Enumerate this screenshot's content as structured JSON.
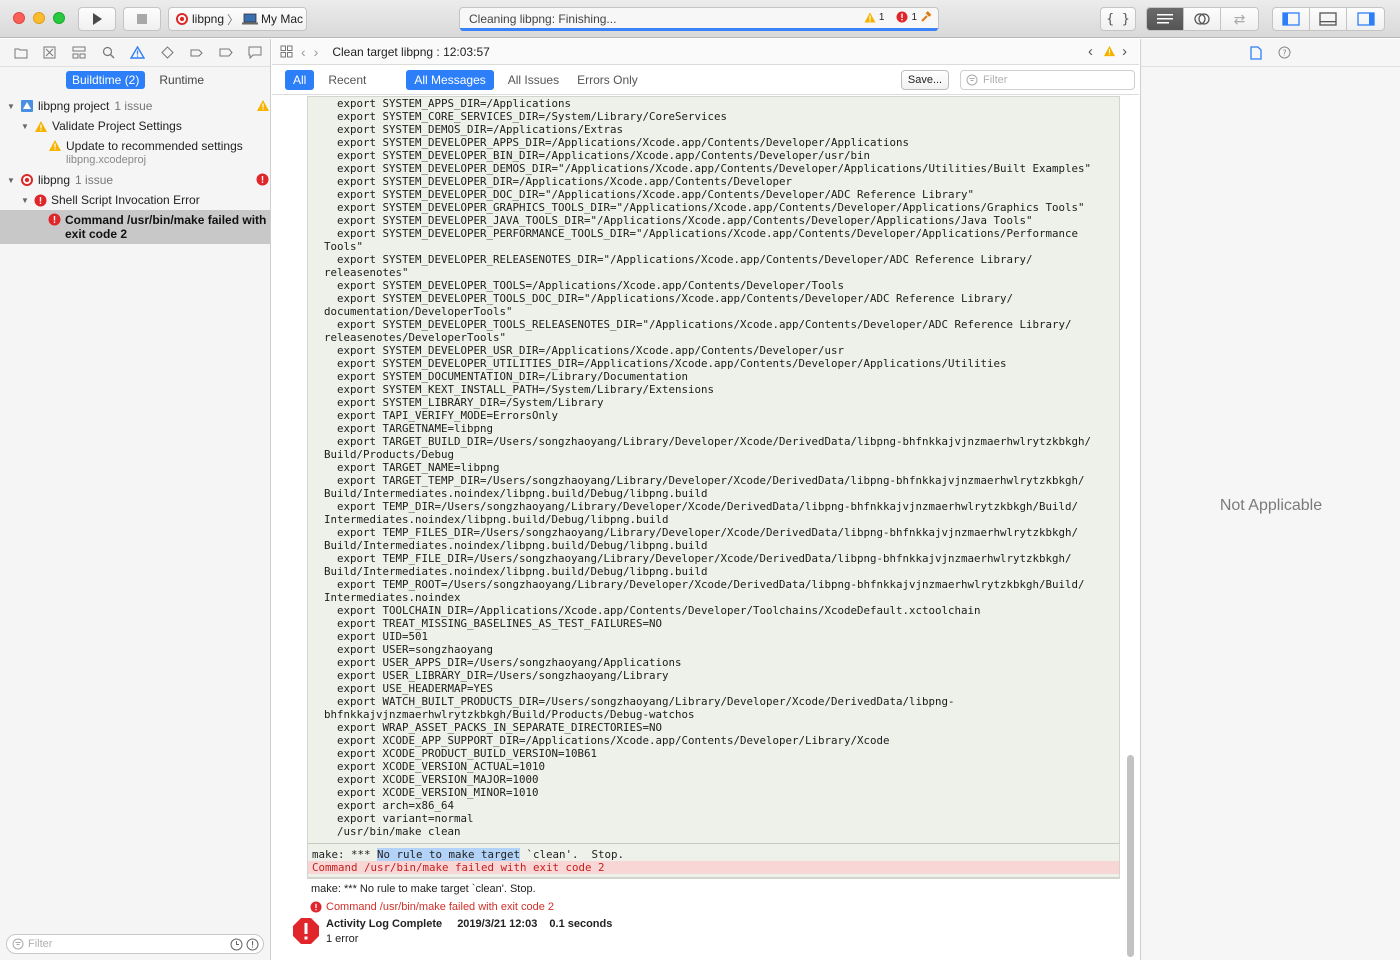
{
  "toolbar": {
    "scheme_name": "libpng",
    "destination": "My Mac",
    "activity_text": "Cleaning libpng: Finishing...",
    "warning_count": "1",
    "error_count": "1"
  },
  "navigator": {
    "mode_tabs": [
      "Buildtime (2)",
      "Runtime"
    ],
    "items": [
      {
        "label": "libpng project",
        "meta": "1 issue"
      },
      {
        "label": "Validate Project Settings"
      },
      {
        "label": "Update to recommended settings",
        "sub": "libpng.xcodeproj"
      },
      {
        "label": "libpng",
        "meta": "1 issue"
      },
      {
        "label": "Shell Script Invocation Error"
      },
      {
        "label_line1": "Command /usr/bin/make failed with",
        "label_line2": "exit code 2"
      }
    ],
    "filter_placeholder": "Filter"
  },
  "editor": {
    "jump_title": "Clean target libpng : 12:03:57",
    "filter_tabs": [
      "All",
      "Recent",
      "All Messages",
      "All Issues",
      "Errors Only"
    ],
    "save_label": "Save...",
    "filter_placeholder": "Filter",
    "log_text": "  export SYSTEM_APPS_DIR=/Applications\n  export SYSTEM_CORE_SERVICES_DIR=/System/Library/CoreServices\n  export SYSTEM_DEMOS_DIR=/Applications/Extras\n  export SYSTEM_DEVELOPER_APPS_DIR=/Applications/Xcode.app/Contents/Developer/Applications\n  export SYSTEM_DEVELOPER_BIN_DIR=/Applications/Xcode.app/Contents/Developer/usr/bin\n  export SYSTEM_DEVELOPER_DEMOS_DIR=\"/Applications/Xcode.app/Contents/Developer/Applications/Utilities/Built Examples\"\n  export SYSTEM_DEVELOPER_DIR=/Applications/Xcode.app/Contents/Developer\n  export SYSTEM_DEVELOPER_DOC_DIR=\"/Applications/Xcode.app/Contents/Developer/ADC Reference Library\"\n  export SYSTEM_DEVELOPER_GRAPHICS_TOOLS_DIR=\"/Applications/Xcode.app/Contents/Developer/Applications/Graphics Tools\"\n  export SYSTEM_DEVELOPER_JAVA_TOOLS_DIR=\"/Applications/Xcode.app/Contents/Developer/Applications/Java Tools\"\n  export SYSTEM_DEVELOPER_PERFORMANCE_TOOLS_DIR=\"/Applications/Xcode.app/Contents/Developer/Applications/Performance\nTools\"\n  export SYSTEM_DEVELOPER_RELEASENOTES_DIR=\"/Applications/Xcode.app/Contents/Developer/ADC Reference Library/\nreleasenotes\"\n  export SYSTEM_DEVELOPER_TOOLS=/Applications/Xcode.app/Contents/Developer/Tools\n  export SYSTEM_DEVELOPER_TOOLS_DOC_DIR=\"/Applications/Xcode.app/Contents/Developer/ADC Reference Library/\ndocumentation/DeveloperTools\"\n  export SYSTEM_DEVELOPER_TOOLS_RELEASENOTES_DIR=\"/Applications/Xcode.app/Contents/Developer/ADC Reference Library/\nreleasenotes/DeveloperTools\"\n  export SYSTEM_DEVELOPER_USR_DIR=/Applications/Xcode.app/Contents/Developer/usr\n  export SYSTEM_DEVELOPER_UTILITIES_DIR=/Applications/Xcode.app/Contents/Developer/Applications/Utilities\n  export SYSTEM_DOCUMENTATION_DIR=/Library/Documentation\n  export SYSTEM_KEXT_INSTALL_PATH=/System/Library/Extensions\n  export SYSTEM_LIBRARY_DIR=/System/Library\n  export TAPI_VERIFY_MODE=ErrorsOnly\n  export TARGETNAME=libpng\n  export TARGET_BUILD_DIR=/Users/songzhaoyang/Library/Developer/Xcode/DerivedData/libpng-bhfnkkajvjnzmaerhwlrytzkbkgh/\nBuild/Products/Debug\n  export TARGET_NAME=libpng\n  export TARGET_TEMP_DIR=/Users/songzhaoyang/Library/Developer/Xcode/DerivedData/libpng-bhfnkkajvjnzmaerhwlrytzkbkgh/\nBuild/Intermediates.noindex/libpng.build/Debug/libpng.build\n  export TEMP_DIR=/Users/songzhaoyang/Library/Developer/Xcode/DerivedData/libpng-bhfnkkajvjnzmaerhwlrytzkbkgh/Build/\nIntermediates.noindex/libpng.build/Debug/libpng.build\n  export TEMP_FILES_DIR=/Users/songzhaoyang/Library/Developer/Xcode/DerivedData/libpng-bhfnkkajvjnzmaerhwlrytzkbkgh/\nBuild/Intermediates.noindex/libpng.build/Debug/libpng.build\n  export TEMP_FILE_DIR=/Users/songzhaoyang/Library/Developer/Xcode/DerivedData/libpng-bhfnkkajvjnzmaerhwlrytzkbkgh/\nBuild/Intermediates.noindex/libpng.build/Debug/libpng.build\n  export TEMP_ROOT=/Users/songzhaoyang/Library/Developer/Xcode/DerivedData/libpng-bhfnkkajvjnzmaerhwlrytzkbkgh/Build/\nIntermediates.noindex\n  export TOOLCHAIN_DIR=/Applications/Xcode.app/Contents/Developer/Toolchains/XcodeDefault.xctoolchain\n  export TREAT_MISSING_BASELINES_AS_TEST_FAILURES=NO\n  export UID=501\n  export USER=songzhaoyang\n  export USER_APPS_DIR=/Users/songzhaoyang/Applications\n  export USER_LIBRARY_DIR=/Users/songzhaoyang/Library\n  export USE_HEADERMAP=YES\n  export WATCH_BUILT_PRODUCTS_DIR=/Users/songzhaoyang/Library/Developer/Xcode/DerivedData/libpng-\nbhfnkkajvjnzmaerhwlrytzkbkgh/Build/Products/Debug-watchos\n  export WRAP_ASSET_PACKS_IN_SEPARATE_DIRECTORIES=NO\n  export XCODE_APP_SUPPORT_DIR=/Applications/Xcode.app/Contents/Developer/Library/Xcode\n  export XCODE_PRODUCT_BUILD_VERSION=10B61\n  export XCODE_VERSION_ACTUAL=1010\n  export XCODE_VERSION_MAJOR=1000\n  export XCODE_VERSION_MINOR=1010\n  export arch=x86_64\n  export variant=normal\n  /usr/bin/make clean",
    "make_prefix": "make: *** ",
    "make_highlight": "No rule to make target",
    "make_suffix": " `clean'.  Stop.",
    "command_failed_mono": "Command /usr/bin/make failed with exit code 2",
    "plain_output": "make: *** No rule to make target `clean'.  Stop.",
    "error_message": "Command /usr/bin/make failed with exit code 2",
    "complete_title": "Activity Log Complete",
    "complete_date": "2019/3/21 12:03",
    "complete_duration": "0.1 seconds",
    "complete_errors": "1 error"
  },
  "inspector": {
    "placeholder": "Not Applicable"
  },
  "colors": {
    "accent": "#2d7ff9",
    "error": "#e0262b",
    "warning": "#f5b300"
  }
}
